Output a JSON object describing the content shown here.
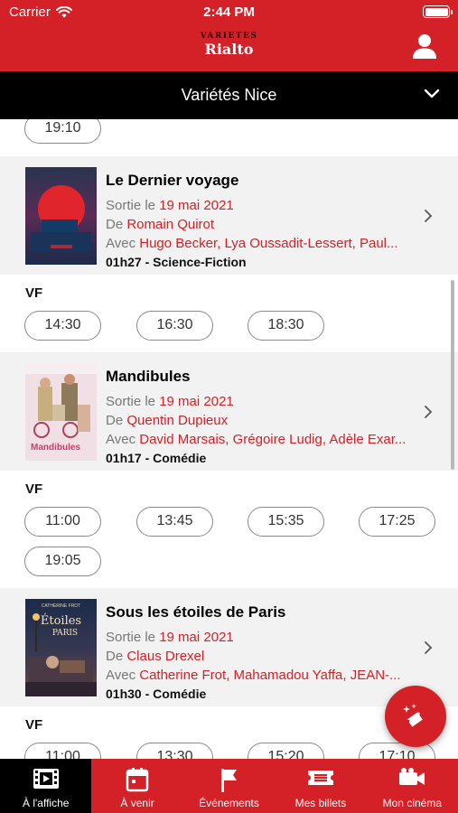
{
  "status_bar": {
    "carrier": "Carrier",
    "time": "2:44 PM"
  },
  "header": {
    "logo_top": "VARIETES",
    "logo_bottom": "Rialto",
    "user_icon": "user-icon"
  },
  "cinema_selector": {
    "label": "Variétés Nice",
    "icon": "chevron-down-icon"
  },
  "top_showtimes": [
    "19:10"
  ],
  "movies": [
    {
      "title": "Le Dernier voyage",
      "release_prefix": "Sortie le ",
      "release_date": "19 mai 2021",
      "director_prefix": "De ",
      "director": "Romain Quirot",
      "cast_prefix": "Avec ",
      "cast": "Hugo Becker, Lya Oussadit-Lessert, Paul...",
      "meta": "01h27 - Science-Fiction",
      "version": "VF",
      "showtimes": [
        "14:30",
        "16:30",
        "18:30"
      ]
    },
    {
      "title": "Mandibules",
      "release_prefix": "Sortie le ",
      "release_date": "19 mai 2021",
      "director_prefix": "De ",
      "director": "Quentin Dupieux",
      "cast_prefix": "Avec ",
      "cast": "David Marsais, Grégoire Ludig, Adèle Exar...",
      "meta": "01h17 - Comédie",
      "version": "VF",
      "showtimes": [
        "11:00",
        "13:45",
        "15:35",
        "17:25",
        "19:05"
      ]
    },
    {
      "title": "Sous les étoiles de Paris",
      "release_prefix": "Sortie le ",
      "release_date": "19 mai 2021",
      "director_prefix": "De ",
      "director": "Claus Drexel",
      "cast_prefix": "Avec ",
      "cast": "Catherine Frot, Mahamadou Yaffa, JEAN-...",
      "meta": "01h30 - Comédie",
      "version": "VF",
      "showtimes": [
        "11:00",
        "13:30",
        "15:20",
        "17:10"
      ]
    }
  ],
  "posters": {
    "mandibules_text": "Mandibules",
    "etoiles_top": "CATHERINE FROT",
    "etoiles_title_1": "Étoiles",
    "etoiles_title_2": "PARIS"
  },
  "fab": {
    "icon": "ticket-magic-icon"
  },
  "tabs": [
    {
      "label": "À l'affiche",
      "icon": "film-icon",
      "active": true
    },
    {
      "label": "À venir",
      "icon": "calendar-icon",
      "active": false
    },
    {
      "label": "Événements",
      "icon": "flag-icon",
      "active": false
    },
    {
      "label": "Mes billets",
      "icon": "ticket-icon",
      "active": false
    },
    {
      "label": "Mon cinéma",
      "icon": "camera-icon",
      "active": false
    }
  ],
  "colors": {
    "brand_red": "#d42027",
    "black": "#000000",
    "row_bg": "#f2f2f2"
  }
}
